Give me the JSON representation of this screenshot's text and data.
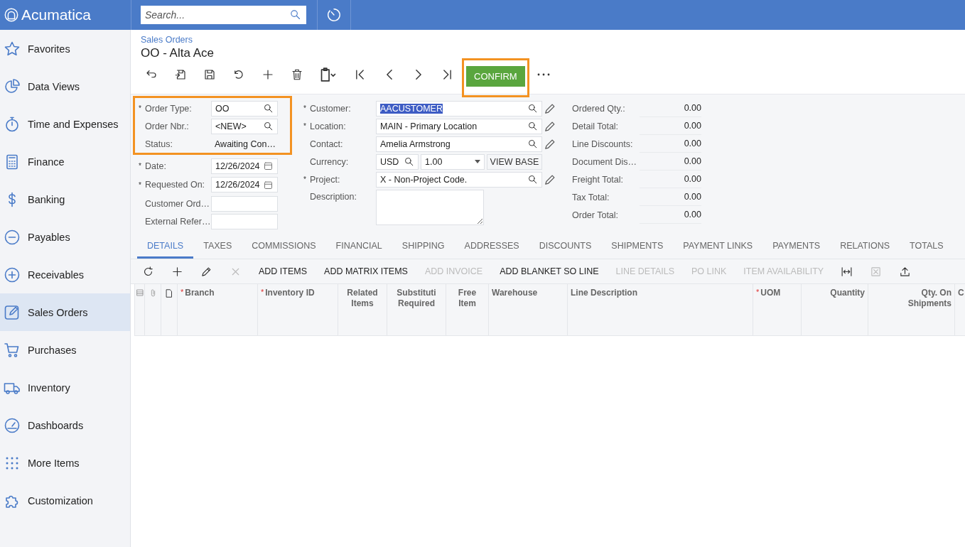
{
  "topbar": {
    "logo": "Acumatica",
    "search": {
      "placeholder": "Search..."
    }
  },
  "sidebar": {
    "items": [
      {
        "label": "Favorites",
        "selected": false
      },
      {
        "label": "Data Views",
        "selected": false
      },
      {
        "label": "Time and Expenses",
        "selected": false
      },
      {
        "label": "Finance",
        "selected": false
      },
      {
        "label": "Banking",
        "selected": false
      },
      {
        "label": "Payables",
        "selected": false
      },
      {
        "label": "Receivables",
        "selected": false
      },
      {
        "label": "Sales Orders",
        "selected": true
      },
      {
        "label": "Purchases",
        "selected": false
      },
      {
        "label": "Inventory",
        "selected": false
      },
      {
        "label": "Dashboards",
        "selected": false
      },
      {
        "label": "More Items",
        "selected": false
      },
      {
        "label": "Customization",
        "selected": false
      }
    ]
  },
  "breadcrumb": "Sales Orders",
  "title": "OO - Alta Ace",
  "toolbar": {
    "confirm": {
      "label": "CONFIRM",
      "highlighted": true
    }
  },
  "form": {
    "column_1": [
      {
        "highlighted": true,
        "fields": [
          {
            "marker": "*",
            "label": "Order Type:",
            "kind": "lookup",
            "value": "OO"
          },
          {
            "label": "Order Nbr.:",
            "kind": "lookup",
            "value": "<NEW>"
          },
          {
            "label": "Status:",
            "kind": "text",
            "value": "Awaiting Con…"
          }
        ]
      },
      {
        "highlighted": false,
        "fields": [
          {
            "marker": "*",
            "label": "Date:",
            "kind": "date",
            "value": "12/26/2024"
          },
          {
            "marker": "*",
            "label": "Requested On:",
            "kind": "date",
            "value": "12/26/2024"
          },
          {
            "label": "Customer Ord…",
            "kind": "input"
          },
          {
            "label": "External Refer…",
            "kind": "input"
          }
        ]
      }
    ],
    "column_2": [
      {
        "marker": "*",
        "label": "Customer:",
        "kind": "lookup",
        "value": "AACUSTOMER",
        "text_selected": true,
        "editable": true
      },
      {
        "marker": "*",
        "label": "Location:",
        "kind": "lookup",
        "value": "MAIN - Primary Location",
        "editable": true
      },
      {
        "label": "Contact:",
        "kind": "lookup",
        "value": "Amelia Armstrong",
        "editable": true
      },
      {
        "label": "Currency:",
        "kind": "currency",
        "value": "USD",
        "rate": "1.00",
        "button": "VIEW BASE",
        "editable": false
      },
      {
        "marker": "*",
        "label": "Project:",
        "kind": "lookup",
        "value": "X - Non-Project Code.",
        "editable": true
      },
      {
        "label": "Description:",
        "kind": "textarea",
        "editable": false
      }
    ],
    "totals": [
      {
        "label": "Ordered Qty.:",
        "value": "0.00"
      },
      {
        "label": "Detail Total:",
        "value": "0.00"
      },
      {
        "label": "Line Discounts:",
        "value": "0.00"
      },
      {
        "label": "Document Dis…",
        "value": "0.00"
      },
      {
        "label": "Freight Total:",
        "value": "0.00"
      },
      {
        "label": "Tax Total:",
        "value": "0.00"
      },
      {
        "label": "Order Total:",
        "value": "0.00"
      }
    ]
  },
  "tabs": [
    {
      "label": "DETAILS",
      "selected": true
    },
    {
      "label": "TAXES",
      "selected": false
    },
    {
      "label": "COMMISSIONS",
      "selected": false
    },
    {
      "label": "FINANCIAL",
      "selected": false
    },
    {
      "label": "SHIPPING",
      "selected": false
    },
    {
      "label": "ADDRESSES",
      "selected": false
    },
    {
      "label": "DISCOUNTS",
      "selected": false
    },
    {
      "label": "SHIPMENTS",
      "selected": false
    },
    {
      "label": "PAYMENT LINKS",
      "selected": false
    },
    {
      "label": "PAYMENTS",
      "selected": false
    },
    {
      "label": "RELATIONS",
      "selected": false
    },
    {
      "label": "TOTALS",
      "selected": false
    }
  ],
  "grid_toolbar": [
    {
      "kind": "icon",
      "disabled": false
    },
    {
      "kind": "icon",
      "disabled": false
    },
    {
      "kind": "icon",
      "disabled": false
    },
    {
      "kind": "icon",
      "disabled": true
    },
    {
      "kind": "text",
      "label": "ADD ITEMS",
      "disabled": false
    },
    {
      "kind": "text",
      "label": "ADD MATRIX ITEMS",
      "disabled": false
    },
    {
      "kind": "text",
      "label": "ADD INVOICE",
      "disabled": true
    },
    {
      "kind": "text",
      "label": "ADD BLANKET SO LINE",
      "disabled": false
    },
    {
      "kind": "text",
      "label": "LINE DETAILS",
      "disabled": true
    },
    {
      "kind": "text",
      "label": "PO LINK",
      "disabled": true
    },
    {
      "kind": "text",
      "label": "ITEM AVAILABILITY",
      "disabled": true
    },
    {
      "kind": "icon",
      "disabled": false
    },
    {
      "kind": "icon",
      "disabled": true
    },
    {
      "kind": "icon",
      "disabled": false
    }
  ],
  "grid": {
    "columns": [
      {
        "marker": "*",
        "label": "Branch"
      },
      {
        "marker": "*",
        "label": "Inventory ID"
      },
      {
        "label": "Related\nItems"
      },
      {
        "label": "Substituti\nRequired"
      },
      {
        "label": "Free\nItem"
      },
      {
        "label": "Warehouse"
      },
      {
        "label": "Line Description"
      },
      {
        "marker": "*",
        "label": "UOM"
      },
      {
        "label": "Quantity"
      },
      {
        "label": "Qty. On\nShipments"
      },
      {
        "label": "C"
      }
    ]
  }
}
